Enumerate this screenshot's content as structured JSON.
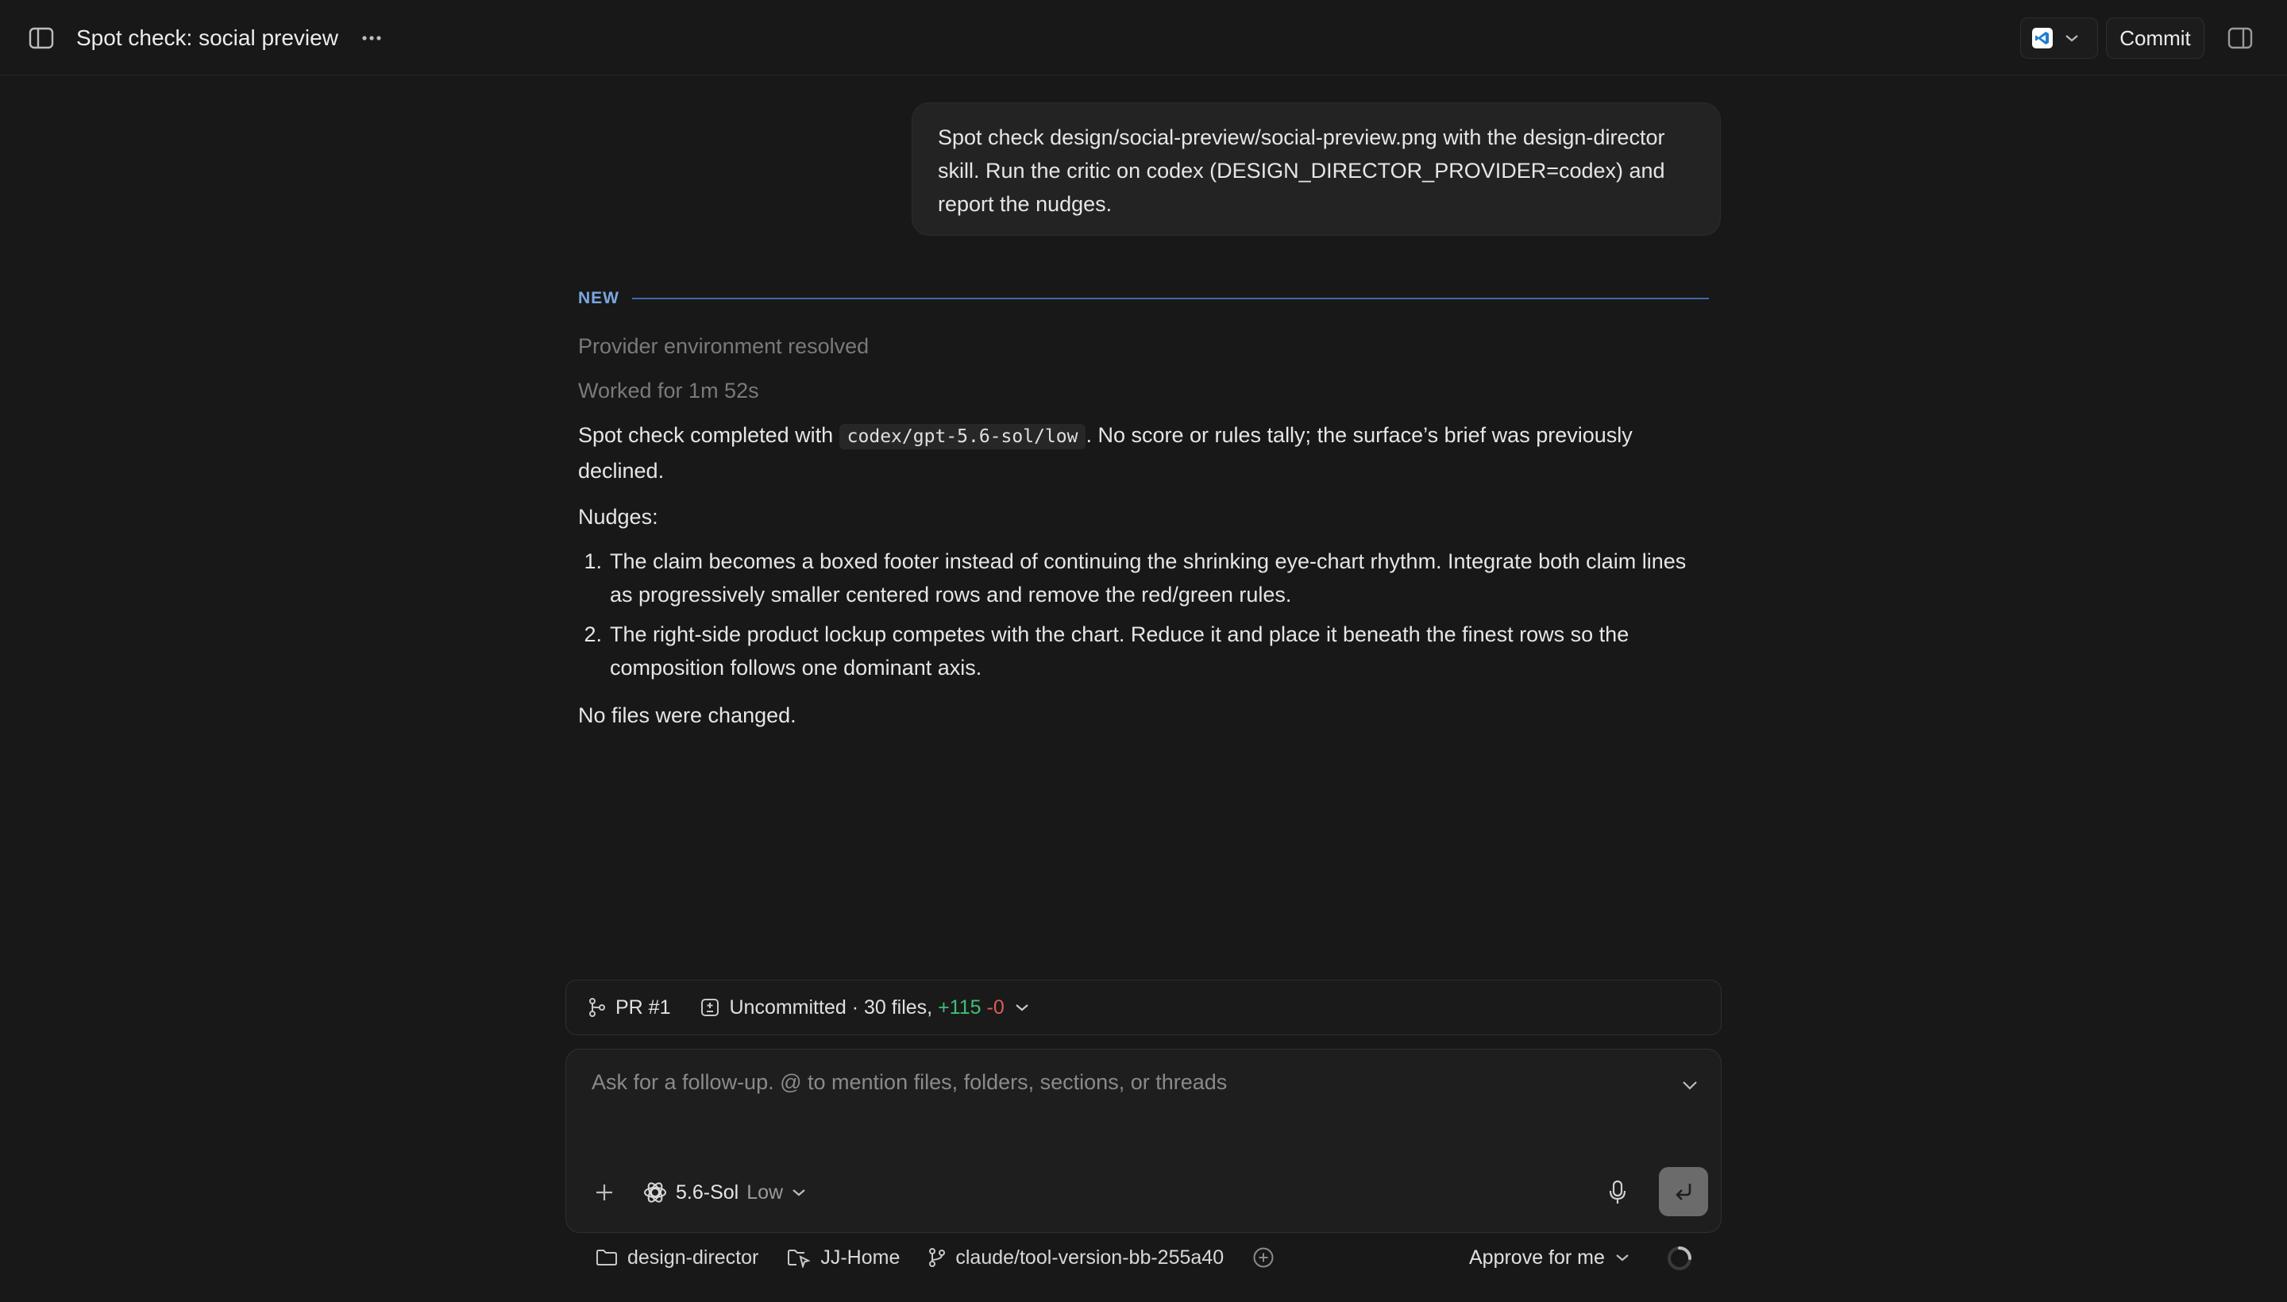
{
  "header": {
    "title": "Spot check: social preview",
    "commit_label": "Commit"
  },
  "user_message": {
    "text": "Spot check design/social-preview/social-preview.png with the design-director skill. Run the critic on codex (DESIGN_DIRECTOR_PROVIDER=codex) and report the nudges."
  },
  "response": {
    "new_label": "NEW",
    "status_lines": [
      "Provider environment resolved",
      "Worked for 1m 52s"
    ],
    "summary_prefix": "Spot check completed with ",
    "summary_code": "codex/gpt-5.6-sol/low",
    "summary_suffix": ". No score or rules tally; the surface’s brief was previously declined.",
    "nudges_label": "Nudges:",
    "nudges": [
      {
        "num": "1.",
        "text": "The claim becomes a boxed footer instead of continuing the shrinking eye-chart rhythm. Integrate both claim lines as progressively smaller centered rows and remove the red/green rules."
      },
      {
        "num": "2.",
        "text": "The right-side product lockup competes with the chart. Reduce it and place it beneath the finest rows so the composition follows one dominant axis."
      }
    ],
    "footer_text": "No files were changed."
  },
  "pr_bar": {
    "pr_label": "PR #1",
    "uncommitted_prefix": "Uncommitted · 30 files, ",
    "additions": "+115",
    "deletions": "-0"
  },
  "composer": {
    "placeholder": "Ask for a follow-up. @ to mention files, folders, sections, or threads",
    "model_name": "5.6-Sol",
    "model_effort": "Low"
  },
  "footer": {
    "folder": "design-director",
    "workspace": "JJ-Home",
    "branch": "claude/tool-version-bb-255a40",
    "approval": "Approve for me"
  },
  "colors": {
    "background": "#181818",
    "accent_blue": "#7aa7e0",
    "additions_green": "#3fbf76",
    "deletions_red": "#e05a5a"
  },
  "icons": [
    "sidebar-toggle-icon",
    "more-icon",
    "vscode-icon",
    "chevron-down-icon",
    "panel-toggle-icon",
    "branch-icon",
    "diff-icon",
    "plus-icon",
    "openai-icon",
    "mic-icon",
    "send-icon",
    "folder-icon",
    "workspace-icon",
    "add-circle-icon",
    "spinner-icon"
  ]
}
